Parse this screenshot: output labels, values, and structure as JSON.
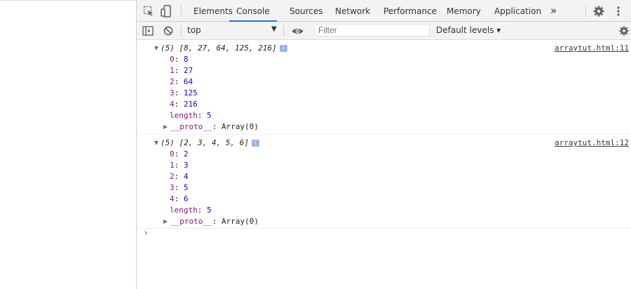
{
  "tabs": {
    "items": [
      "Elements",
      "Console",
      "Sources",
      "Network",
      "Performance",
      "Memory",
      "Application"
    ],
    "more": "»"
  },
  "toolbar": {
    "context": "top",
    "filter_placeholder": "Filter",
    "levels": "Default levels ▾"
  },
  "messages": [
    {
      "summary": "(5) [8, 27, 64, 125, 216]",
      "source": "arraytut.html:11",
      "entries": [
        {
          "key": "0",
          "value": "8"
        },
        {
          "key": "1",
          "value": "27"
        },
        {
          "key": "2",
          "value": "64"
        },
        {
          "key": "3",
          "value": "125"
        },
        {
          "key": "4",
          "value": "216"
        }
      ],
      "length_key": "length",
      "length_value": "5",
      "proto_key": "__proto__",
      "proto_value": "Array(0)"
    },
    {
      "summary": "(5) [2, 3, 4, 5, 6]",
      "source": "arraytut.html:12",
      "entries": [
        {
          "key": "0",
          "value": "2"
        },
        {
          "key": "1",
          "value": "3"
        },
        {
          "key": "2",
          "value": "4"
        },
        {
          "key": "3",
          "value": "5"
        },
        {
          "key": "4",
          "value": "6"
        }
      ],
      "length_key": "length",
      "length_value": "5",
      "proto_key": "__proto__",
      "proto_value": "Array(0)"
    }
  ],
  "prompt": "›"
}
